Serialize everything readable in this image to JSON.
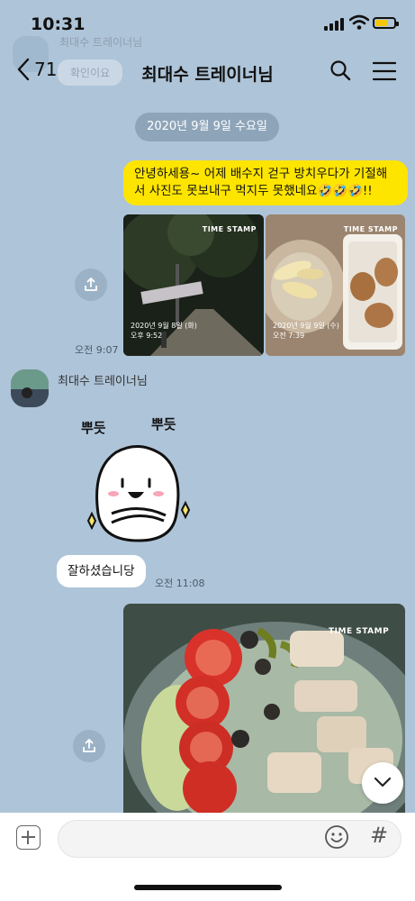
{
  "status_bar": {
    "time": "10:31"
  },
  "ghost": {
    "name": "최대수 트레이너님",
    "bubble": "확인이요"
  },
  "header": {
    "unread_count": "71",
    "title": "최대수 트레이너님"
  },
  "date_divider": "2020년 9월 9일 수요일",
  "messages": {
    "outgoing_text": "안녕하세용~ 어제 배수지 걷구 방치우다가 기절해서 사진도 못보내구 먹지두 못했네요🤣🤣🤣!!",
    "photo1": {
      "stamp": "TIME STAMP",
      "date": "2020년 9월 8일 (화)",
      "time": "오후 9:52"
    },
    "photo2": {
      "stamp": "TIME STAMP",
      "date": "2020년 9월 9일 (수)",
      "time": "오전 7:39"
    },
    "photos_time": "오전 9:07",
    "sender_name": "최대수 트레이너님",
    "sticker_text_left": "뿌듯",
    "sticker_text_right": "뿌듯",
    "incoming_text": "잘하셨습니당",
    "incoming_time": "오전 11:08",
    "photo3": {
      "stamp": "TIME STAMP"
    }
  },
  "input": {
    "placeholder": "",
    "hash_symbol": "#"
  },
  "colors": {
    "background": "#aec4d8",
    "outgoing_bubble": "#fee500",
    "incoming_bubble": "#ffffff"
  }
}
